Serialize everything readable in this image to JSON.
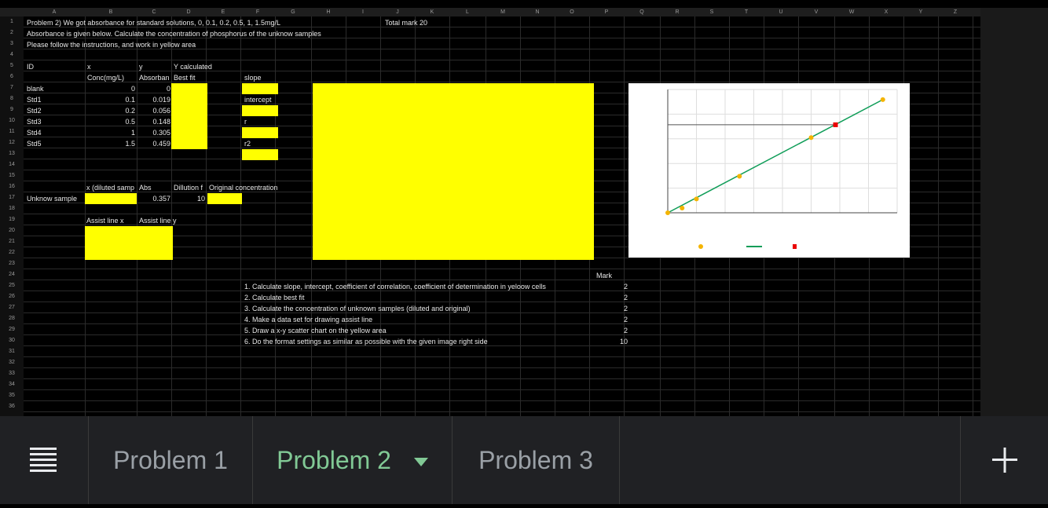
{
  "columns": [
    "A",
    "B",
    "C",
    "D",
    "E",
    "F",
    "G",
    "H",
    "I",
    "J",
    "K",
    "L",
    "M",
    "N",
    "O",
    "P",
    "Q",
    "R",
    "S",
    "T",
    "U",
    "V",
    "W",
    "X",
    "Y",
    "Z"
  ],
  "rows": [
    "1",
    "2",
    "3",
    "4",
    "5",
    "6",
    "7",
    "8",
    "9",
    "10",
    "11",
    "12",
    "13",
    "14",
    "15",
    "16",
    "17",
    "18",
    "19",
    "20",
    "21",
    "22",
    "23",
    "24",
    "25",
    "26",
    "27",
    "28",
    "29",
    "30",
    "31",
    "32",
    "33",
    "34",
    "35",
    "36"
  ],
  "cells": {
    "problem_title": "Problem 2) We got absorbance for standard solutions, 0, 0.1, 0.2, 0.5, 1, 1.5mg/L",
    "total_mark": "Total mark 20",
    "absorbance_note": "Absorbance is given below. Calculate the concentration of phosphorus of the unknow samples",
    "follow_note": "Please follow the instructions, and work in yellow area",
    "id_header": "ID",
    "x_header": "x",
    "y_header": "y",
    "ycalc_header": "Y calculated",
    "conc_header": "Conc(mg/L)",
    "abs_header": "Absorban",
    "bestfit_header": "Best fit",
    "slope_label": "slope",
    "intercept_label": "intercept",
    "r_label": "r",
    "r2_label": "r2",
    "standards": [
      {
        "id": "blank",
        "conc": "0",
        "abs": "0"
      },
      {
        "id": "Std1",
        "conc": "0.1",
        "abs": "0.019"
      },
      {
        "id": "Std2",
        "conc": "0.2",
        "abs": "0.056"
      },
      {
        "id": "Std3",
        "conc": "0.5",
        "abs": "0.148"
      },
      {
        "id": "Std4",
        "conc": "1",
        "abs": "0.305"
      },
      {
        "id": "Std5",
        "conc": "1.5",
        "abs": "0.459"
      }
    ],
    "x_diluted_header": "x (diluted samp",
    "abs2_header": "Abs",
    "dilution_header": "Dillution f",
    "original_conc_header": "Original concentration",
    "unknown_label": "Unknow sample",
    "unknown_abs": "0.357",
    "dilution_factor": "10",
    "assist_x": "Assist line x",
    "assist_y": "Assist line y",
    "mark_header": "Mark",
    "instructions": [
      {
        "text": "1. Calculate slope, intercept, coefficient of correlation, coefficient of determination in yeloow cells",
        "mark": "2"
      },
      {
        "text": "2. Calculate best fit",
        "mark": "2"
      },
      {
        "text": "3. Calculate the concentration of unknown samples (diluted and original)",
        "mark": "2"
      },
      {
        "text": "4. Make a data set for drawing assist line",
        "mark": "2"
      },
      {
        "text": "5. Draw a x-y scatter chart on the yellow area",
        "mark": "2"
      },
      {
        "text": "6. Do the format settings as similar as possible with the given image right side",
        "mark": "10"
      }
    ]
  },
  "colors": {
    "yellow_area": "#ffff00",
    "standards_marker": "#f4b400",
    "bestfit_line": "#0f9d58",
    "unknown_marker": "#ea0000",
    "active_tab": "#81c995"
  },
  "chart_data": {
    "type": "scatter",
    "series": [
      {
        "marker": "circle",
        "x": [
          0,
          0.1,
          0.2,
          0.5,
          1,
          1.5
        ],
        "y": [
          0,
          0.019,
          0.056,
          0.148,
          0.305,
          0.459
        ]
      },
      {
        "marker": "line",
        "x": [
          0,
          1.5
        ],
        "y": [
          0,
          0.459
        ]
      },
      {
        "marker": "square",
        "x": [
          1.17
        ],
        "y": [
          0.357
        ]
      }
    ],
    "assist_line_y": 0.357,
    "xlim": [
      0,
      1.6
    ],
    "ylim": [
      0,
      0.5
    ],
    "grid": true,
    "legend": "bottom"
  },
  "tabs": {
    "menu_icon": "list-icon",
    "items": [
      {
        "label": "Problem 1"
      },
      {
        "label": "Problem 2"
      },
      {
        "label": "Problem 3"
      }
    ],
    "add_icon": "plus-icon"
  }
}
